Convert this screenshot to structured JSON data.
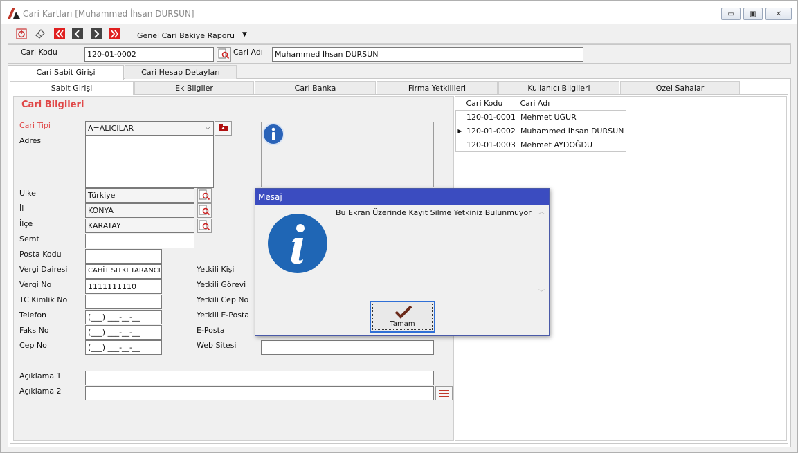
{
  "window": {
    "title": "Cari Kartları [Muhammed İhsan DURSUN]",
    "controls": {
      "minimize": "▭",
      "restore": "▣",
      "close": "✕"
    }
  },
  "toolbar": {
    "report_label": "Genel Cari Bakiye Raporu",
    "icons": [
      "power-icon",
      "eraser-icon",
      "first-record-icon",
      "previous-record-icon",
      "next-record-icon",
      "last-record-icon"
    ]
  },
  "search": {
    "code_label": "Cari Kodu",
    "code_value": "120-01-0002",
    "name_label": "Cari Adı",
    "name_value": "Muhammed İhsan DURSUN"
  },
  "main_tabs": [
    "Cari Sabit Girişi",
    "Cari Hesap Detayları"
  ],
  "sub_tabs": [
    "Sabit Girişi",
    "Ek Bilgiler",
    "Cari Banka",
    "Firma Yetkilileri",
    "Kullanıcı Bilgileri",
    "Özel Sahalar"
  ],
  "form": {
    "section_title": "Cari Bilgileri",
    "cari_tipi_label": "Cari Tipi",
    "cari_tipi_value": "A=ALICILAR",
    "adres_label": "Adres",
    "ulke_label": "Ülke",
    "ulke_value": "Türkiye",
    "il_label": "İl",
    "il_value": "KONYA",
    "ilce_label": "İlçe",
    "ilce_value": "KARATAY",
    "semt_label": "Semt",
    "posta_label": "Posta Kodu",
    "vergi_dairesi_label": "Vergi Dairesi",
    "vergi_dairesi_value": "CAHİT SITKI TARANCI",
    "vergi_no_label": "Vergi No",
    "vergi_no_value": "1111111110",
    "tc_label": "TC Kimlik No",
    "telefon_label": "Telefon",
    "telefon_mask": "(___) ___-__-__",
    "faks_label": "Faks No",
    "faks_mask": "(___) ___-__-__",
    "cep_label": "Cep No",
    "cep_mask": "(___) ___-__-__",
    "yetkili_kisi_label": "Yetkili Kişi",
    "yetkili_gorev_label": "Yetkili Görevi",
    "yetkili_cep_label": "Yetkili Cep No",
    "yetkili_eposta_label": "Yetkili E-Posta",
    "eposta_label": "E-Posta",
    "web_label": "Web Sitesi",
    "aciklama1_label": "Açıklama 1",
    "aciklama2_label": "Açıklama 2"
  },
  "grid": {
    "headers": [
      "Cari Kodu",
      "Cari Adı"
    ],
    "rows": [
      {
        "code": "120-01-0001",
        "name": "Mehmet UĞUR"
      },
      {
        "code": "120-01-0002",
        "name": "Muhammed İhsan DURSUN"
      },
      {
        "code": "120-01-0003",
        "name": "Mehmet AYDOĞDU"
      }
    ],
    "current_row_marker": "▶"
  },
  "dialog": {
    "title": "Mesaj",
    "message": "Bu Ekran Üzerinde Kayıt Silme Yetkiniz Bulunmuyor",
    "ok_label": "Tamam",
    "scroll_up": "︿",
    "scroll_down": "﹀"
  },
  "colors": {
    "accent_red": "#e04848",
    "dialog_title": "#3b4cc0",
    "info_blue": "#1f66b5",
    "ok_check": "#6b2a1a"
  }
}
